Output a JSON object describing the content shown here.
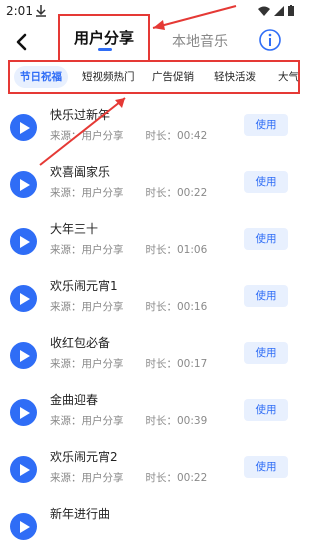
{
  "status": {
    "time": "2:01"
  },
  "nav": {
    "tab_main": "用户分享",
    "tab_local": "本地音乐"
  },
  "chips": [
    "节日祝福",
    "短视频热门",
    "广告促销",
    "轻快活泼",
    "大气磅礴"
  ],
  "list": [
    {
      "title": "快乐过新年",
      "source": "来源：用户分享",
      "duration": "时长：00:42",
      "action": "使用"
    },
    {
      "title": "欢喜阖家乐",
      "source": "来源：用户分享",
      "duration": "时长：00:22",
      "action": "使用"
    },
    {
      "title": "大年三十",
      "source": "来源：用户分享",
      "duration": "时长：01:06",
      "action": "使用"
    },
    {
      "title": "欢乐闹元宵1",
      "source": "来源：用户分享",
      "duration": "时长：00:16",
      "action": "使用"
    },
    {
      "title": "收红包必备",
      "source": "来源：用户分享",
      "duration": "时长：00:17",
      "action": "使用"
    },
    {
      "title": "金曲迎春",
      "source": "来源：用户分享",
      "duration": "时长：00:39",
      "action": "使用"
    },
    {
      "title": "欢乐闹元宵2",
      "source": "来源：用户分享",
      "duration": "时长：00:22",
      "action": "使用"
    },
    {
      "title": "新年进行曲",
      "source": "",
      "duration": "",
      "action": ""
    }
  ],
  "colors": {
    "accent": "#2f6df6",
    "highlight": "#e53935"
  }
}
